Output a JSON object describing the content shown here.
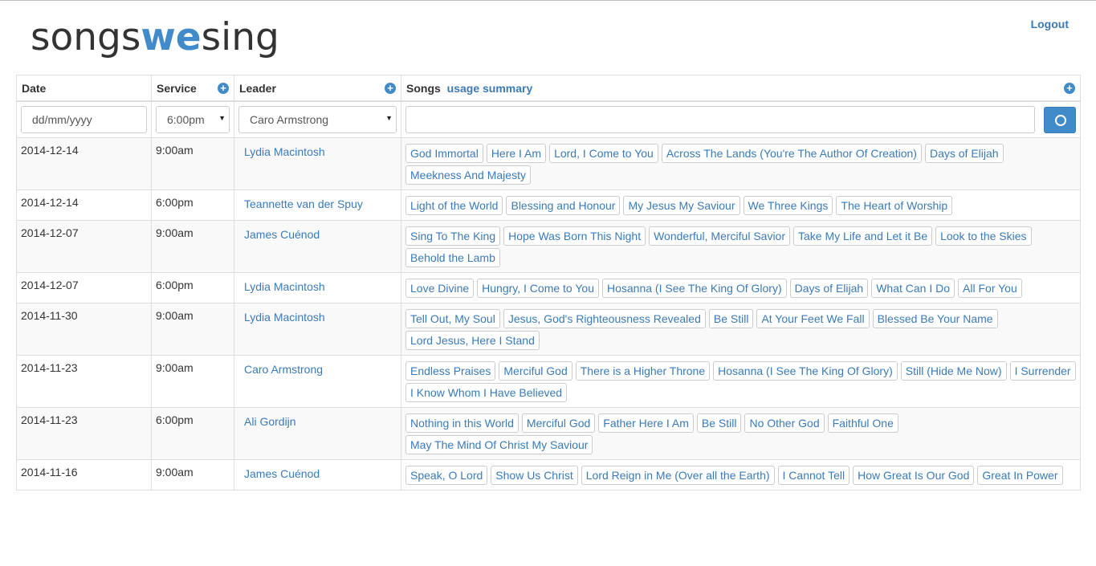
{
  "header": {
    "logo_pre": "songs",
    "logo_mid": "we",
    "logo_post": "sing",
    "logout": "Logout"
  },
  "table": {
    "columns": {
      "date": "Date",
      "service": "Service",
      "leader": "Leader",
      "songs": "Songs",
      "usage_summary": "usage summary"
    },
    "filters": {
      "date_placeholder": "dd/mm/yyyy",
      "service_value": "6:00pm",
      "leader_value": "Caro Armstrong",
      "songs_value": ""
    },
    "rows": [
      {
        "date": "2014-12-14",
        "service": "9:00am",
        "leader": "Lydia Macintosh",
        "songs": [
          "God Immortal",
          "Here I Am",
          "Lord, I Come to You",
          "Across The Lands (You're The Author Of Creation)",
          "Days of Elijah",
          "Meekness And Majesty"
        ]
      },
      {
        "date": "2014-12-14",
        "service": "6:00pm",
        "leader": "Teannette van der Spuy",
        "songs": [
          "Light of the World",
          "Blessing and Honour",
          "My Jesus My Saviour",
          "We Three Kings",
          "The Heart of Worship"
        ]
      },
      {
        "date": "2014-12-07",
        "service": "9:00am",
        "leader": "James Cuénod",
        "songs": [
          "Sing To The King",
          "Hope Was Born This Night",
          "Wonderful, Merciful Savior",
          "Take My Life and Let it Be",
          "Look to the Skies",
          "Behold the Lamb"
        ]
      },
      {
        "date": "2014-12-07",
        "service": "6:00pm",
        "leader": "Lydia Macintosh",
        "songs": [
          "Love Divine",
          "Hungry, I Come to You",
          "Hosanna (I See The King Of Glory)",
          "Days of Elijah",
          "What Can I Do",
          "All For You"
        ]
      },
      {
        "date": "2014-11-30",
        "service": "9:00am",
        "leader": "Lydia Macintosh",
        "songs": [
          "Tell Out, My Soul",
          "Jesus, God's Righteousness Revealed",
          "Be Still",
          "At Your Feet We Fall",
          "Blessed Be Your Name",
          "Lord Jesus, Here I Stand"
        ]
      },
      {
        "date": "2014-11-23",
        "service": "9:00am",
        "leader": "Caro Armstrong",
        "songs": [
          "Endless Praises",
          "Merciful God",
          "There is a Higher Throne",
          "Hosanna (I See The King Of Glory)",
          "Still (Hide Me Now)",
          "I Surrender",
          "I Know Whom I Have Believed"
        ]
      },
      {
        "date": "2014-11-23",
        "service": "6:00pm",
        "leader": "Ali Gordijn",
        "songs": [
          "Nothing in this World",
          "Merciful God",
          "Father Here I Am",
          "Be Still",
          "No Other God",
          "Faithful One",
          "May The Mind Of Christ My Saviour"
        ]
      },
      {
        "date": "2014-11-16",
        "service": "9:00am",
        "leader": "James Cuénod",
        "songs": [
          "Speak, O Lord",
          "Show Us Christ",
          "Lord Reign in Me (Over all the Earth)",
          "I Cannot Tell",
          "How Great Is Our God",
          "Great In Power"
        ]
      }
    ]
  },
  "colors": {
    "accent": "#428bca",
    "link": "#3a7ab8"
  }
}
